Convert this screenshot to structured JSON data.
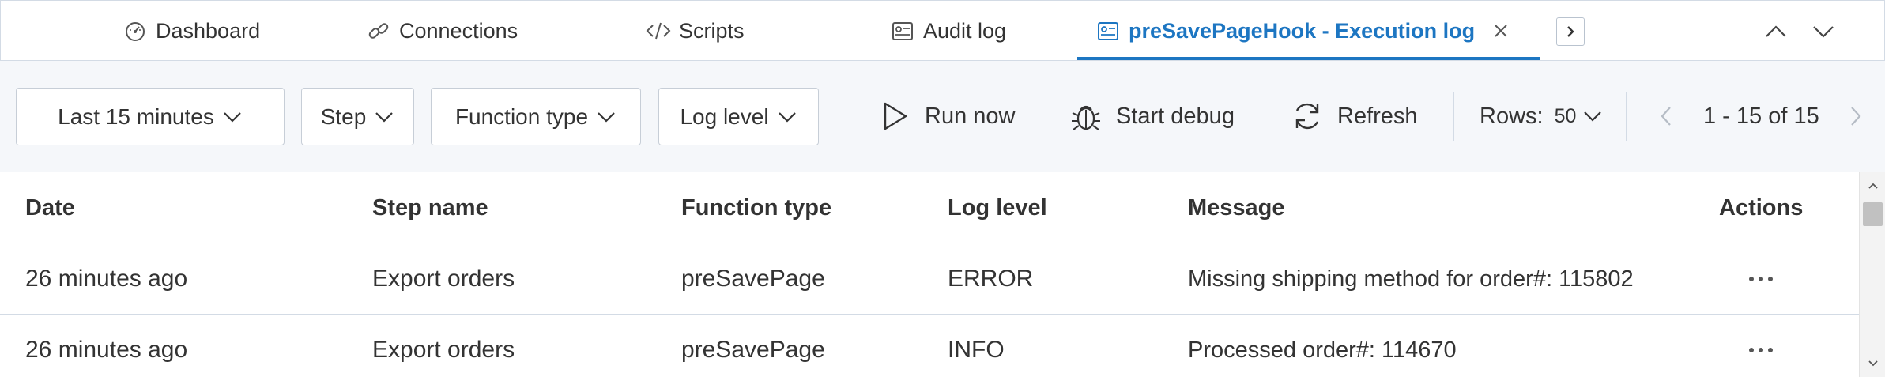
{
  "tabs": [
    {
      "label": "Dashboard",
      "icon": "dashboard-icon"
    },
    {
      "label": "Connections",
      "icon": "link-icon"
    },
    {
      "label": "Scripts",
      "icon": "code-icon"
    },
    {
      "label": "Audit log",
      "icon": "audit-log-icon"
    },
    {
      "label": "preSavePageHook - Execution log",
      "icon": "execution-log-icon",
      "active": true
    }
  ],
  "filters": {
    "time_range": "Last 15 minutes",
    "step": "Step",
    "function_type": "Function type",
    "log_level": "Log level"
  },
  "actions": {
    "run_now": "Run now",
    "start_debug": "Start debug",
    "refresh": "Refresh"
  },
  "pagination": {
    "rows_label": "Rows:",
    "rows_value": "50",
    "range": "1 - 15 of 15"
  },
  "table": {
    "columns": [
      "Date",
      "Step name",
      "Function type",
      "Log level",
      "Message",
      "Actions"
    ],
    "rows": [
      {
        "date": "26 minutes ago",
        "step": "Export orders",
        "function_type": "preSavePage",
        "log_level": "ERROR",
        "message": "Missing shipping method for order#: 115802"
      },
      {
        "date": "26 minutes ago",
        "step": "Export orders",
        "function_type": "preSavePage",
        "log_level": "INFO",
        "message": "Processed order#: 114670"
      }
    ]
  },
  "colors": {
    "accent": "#1d76c2",
    "toolbar_bg": "#f5f7fa",
    "border": "#d3dbe5"
  }
}
